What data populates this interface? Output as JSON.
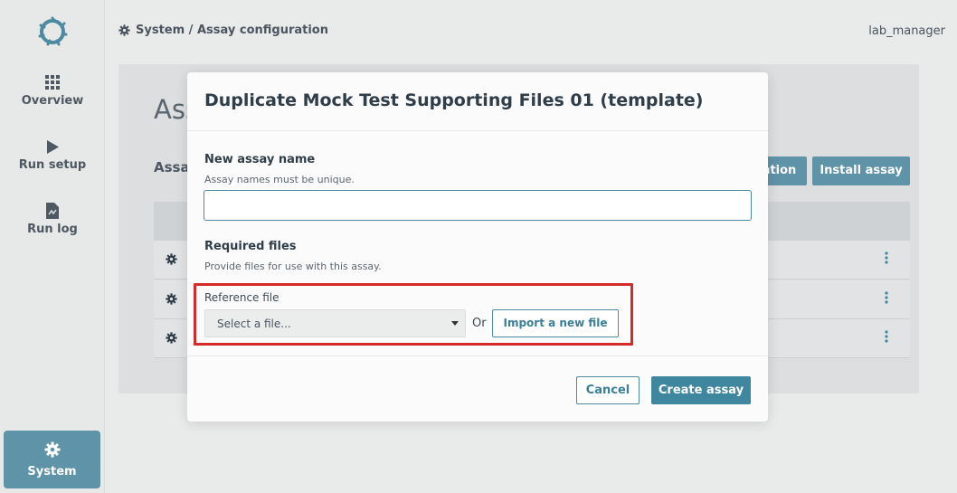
{
  "app": {
    "breadcrumb": "System / Assay configuration",
    "user": "lab_manager"
  },
  "sidebar": {
    "items": [
      {
        "label": "Overview",
        "icon": "grid-icon"
      },
      {
        "label": "Run setup",
        "icon": "play-icon"
      },
      {
        "label": "Run log",
        "icon": "document-icon"
      },
      {
        "label": "System",
        "icon": "gear-icon",
        "active": true
      }
    ]
  },
  "background": {
    "title_fragment": "Ass",
    "subtitle_fragment": "Assa",
    "buttons": [
      {
        "label": "ation"
      },
      {
        "label": "Install assay"
      }
    ]
  },
  "modal": {
    "title": "Duplicate Mock Test Supporting Files 01 (template)",
    "name_label": "New assay name",
    "name_help": "Assay names must be unique.",
    "name_value": "",
    "files_label": "Required files",
    "files_help": "Provide files for use with this assay.",
    "reference_label": "Reference file",
    "select_placeholder": "Select a file...",
    "or_text": "Or",
    "import_button": "Import a new file",
    "cancel_button": "Cancel",
    "create_button": "Create assay"
  },
  "colors": {
    "accent": "#3f879f",
    "sidebar_active": "#5f93a8",
    "highlight": "#d52a2a"
  }
}
